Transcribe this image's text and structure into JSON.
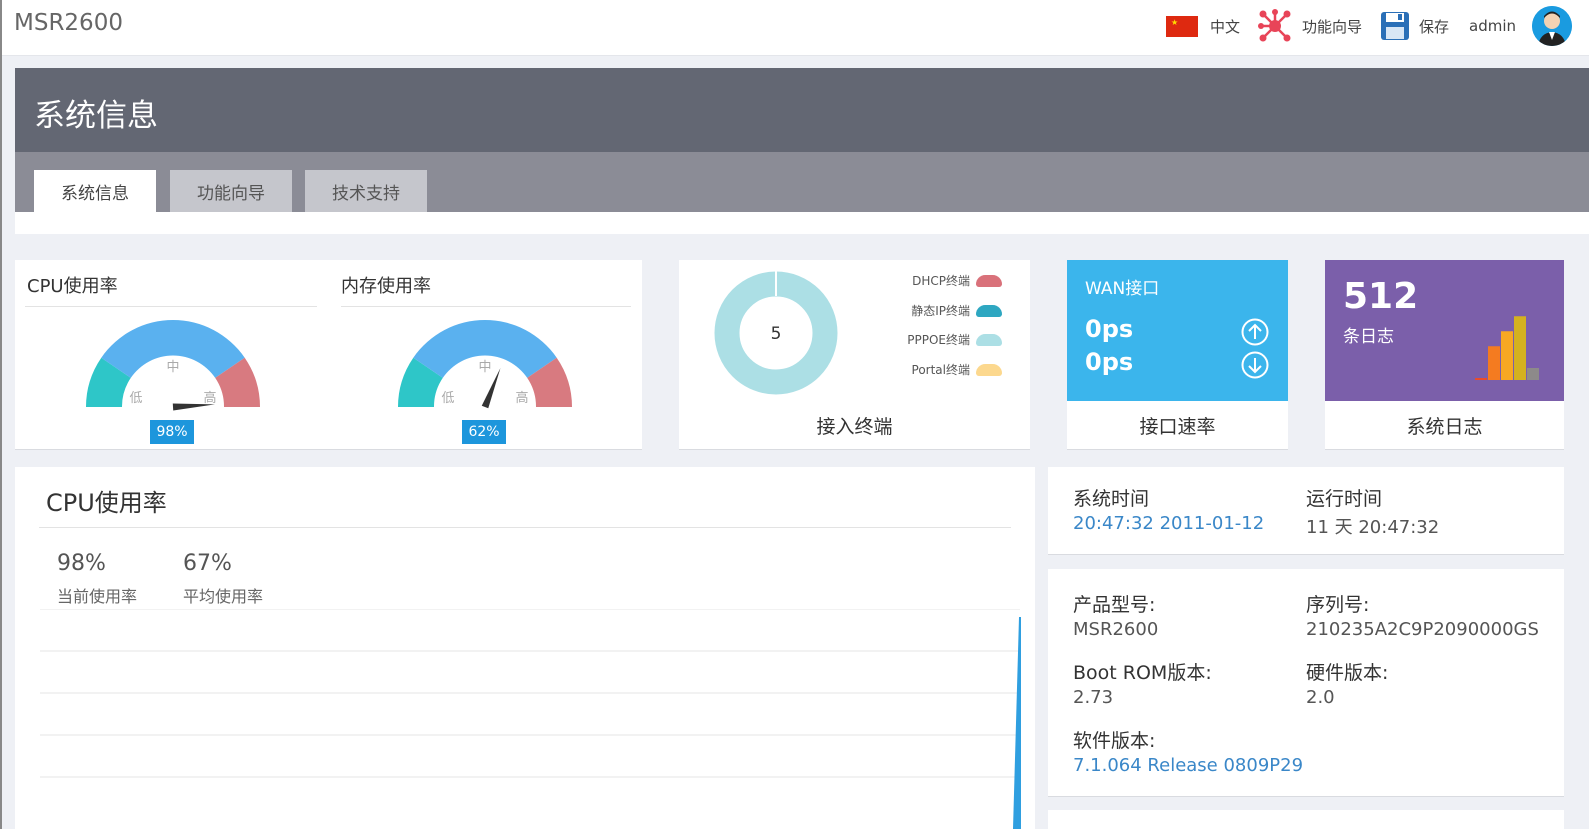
{
  "header": {
    "brand": "MSR2600",
    "language": "中文",
    "wizard": "功能向导",
    "save": "保存",
    "user": "admin"
  },
  "page": {
    "title": "系统信息",
    "tabs": [
      {
        "label": "系统信息",
        "active": true
      },
      {
        "label": "功能向导",
        "active": false
      },
      {
        "label": "技术支持",
        "active": false
      }
    ]
  },
  "gauges": [
    {
      "title": "CPU使用率",
      "value_label": "98%",
      "value": 98,
      "low": "低",
      "mid": "中",
      "high": "高"
    },
    {
      "title": "内存使用率",
      "value_label": "62%",
      "value": 62,
      "low": "低",
      "mid": "中",
      "high": "高"
    }
  ],
  "terminals": {
    "count": "5",
    "caption": "接入终端",
    "legend": [
      {
        "label": "DHCP终端",
        "color": "#d9717a"
      },
      {
        "label": "静态IP终端",
        "color": "#2ea7c1"
      },
      {
        "label": "PPPOE终端",
        "color": "#acdfe5"
      },
      {
        "label": "Portal终端",
        "color": "#fcd88e"
      }
    ],
    "ring_color": "#acdfe5"
  },
  "wan": {
    "title": "WAN接口",
    "up": "0ps",
    "down": "0ps",
    "caption": "接口速率",
    "color": "#3bb5ec"
  },
  "logs": {
    "count": "512",
    "unit": "条日志",
    "caption": "系统日志",
    "color": "#7b5faa",
    "bars": [
      0.02,
      0.45,
      0.65,
      0.85,
      0.16
    ],
    "bar_colors": [
      "#e84c2b",
      "#f47b20",
      "#f7a823",
      "#d4b11f",
      "#8d8a8a"
    ]
  },
  "cpu_panel": {
    "title": "CPU使用率",
    "current": "98%",
    "current_label": "当前使用率",
    "average": "67%",
    "average_label": "平均使用率"
  },
  "system_time": {
    "time_label": "系统时间",
    "time_value": "20:47:32  2011-01-12",
    "uptime_label": "运行时间",
    "uptime_value": "11 天  20:47:32"
  },
  "product": {
    "model_label": "产品型号:",
    "model_value": "MSR2600",
    "serial_label": "序列号:",
    "serial_value": "210235A2C9P2090000GS",
    "bootrom_label": "Boot ROM版本:",
    "bootrom_value": "2.73",
    "hardware_label": "硬件版本:",
    "hardware_value": "2.0",
    "software_label": "软件版本:",
    "software_value": "7.1.064 Release 0809P29"
  }
}
